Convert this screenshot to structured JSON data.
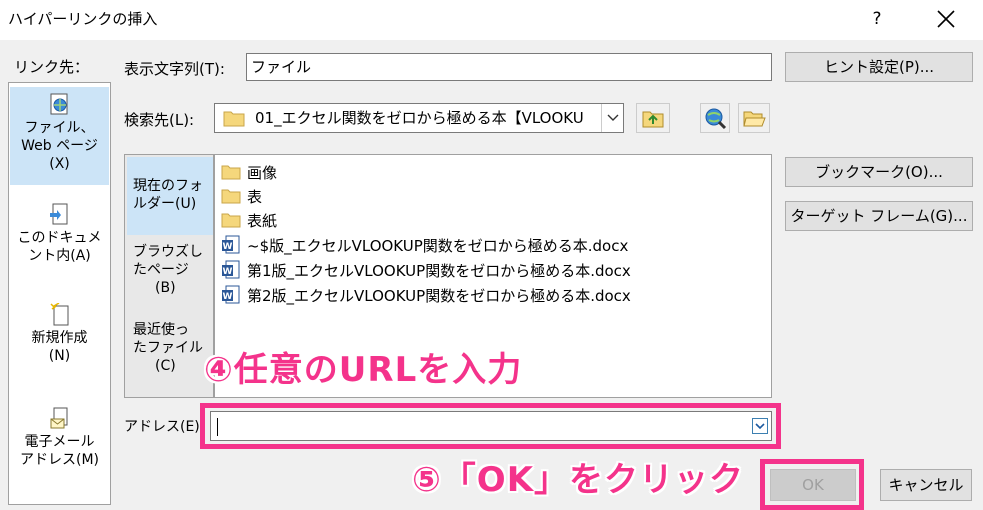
{
  "window": {
    "title": "ハイパーリンクの挿入",
    "help_label": "?"
  },
  "link_to": {
    "label": "リンク先：",
    "items": [
      {
        "line1": "ファイル、",
        "line2": "Web ページ",
        "line3": "(X)",
        "icon": "web-page-icon"
      },
      {
        "line1": "このドキュメ",
        "line2": "ント内(A)",
        "icon": "document-place-icon"
      },
      {
        "line1": "新規作成",
        "line2": "(N)",
        "icon": "new-document-icon"
      },
      {
        "line1": "電子メール",
        "line2": "アドレス(M)",
        "icon": "email-icon"
      }
    ]
  },
  "display_text": {
    "label": "表示文字列(T):",
    "value": "ファイル"
  },
  "screentip_button": "ヒント設定(P)...",
  "look_in": {
    "label": "検索先(L):",
    "value": "01_エクセル関数をゼロから極める本【VLOOKU"
  },
  "browse_tabs": [
    {
      "line1": "現在のフォ",
      "line2": "ルダー(U)"
    },
    {
      "line1": "ブラウズし",
      "line2": "たページ",
      "line3": "(B)"
    },
    {
      "line1": "最近使っ",
      "line2": "たファイル",
      "line3": "(C)"
    }
  ],
  "files": [
    {
      "name": "画像",
      "type": "folder"
    },
    {
      "name": "表",
      "type": "folder"
    },
    {
      "name": "表紙",
      "type": "folder"
    },
    {
      "name": "~$版_エクセルVLOOKUP関数をゼロから極める本.docx",
      "type": "docx"
    },
    {
      "name": "第1版_エクセルVLOOKUP関数をゼロから極める本.docx",
      "type": "docx"
    },
    {
      "name": "第2版_エクセルVLOOKUP関数をゼロから極める本.docx",
      "type": "docx"
    }
  ],
  "bookmark_button": "ブックマーク(O)...",
  "target_frame_button": "ターゲット フレーム(G)...",
  "address": {
    "label": "アドレス(E):",
    "value": ""
  },
  "ok_button": "OK",
  "cancel_button": "キャンセル",
  "annotations": {
    "step4": "④任意のURLを入力",
    "step5": "⑤「OK」をクリック"
  },
  "colors": {
    "annotation": "#f4338b",
    "selection": "#cce4f7"
  }
}
